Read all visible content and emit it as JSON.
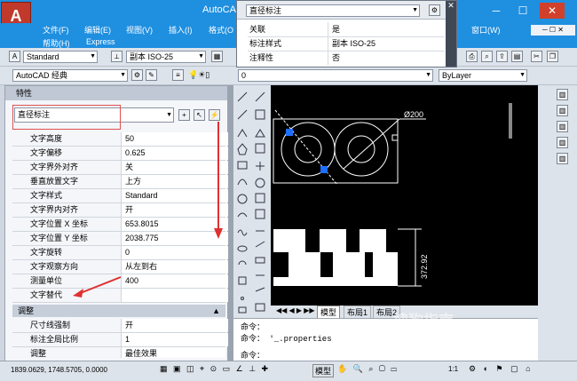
{
  "app": {
    "title": "AutoCAD"
  },
  "menu": {
    "items": [
      "文件(F)",
      "编辑(E)",
      "视图(V)",
      "插入(I)",
      "格式(O",
      "窗口(W)",
      "帮助(H)",
      "Express"
    ]
  },
  "toolbar1": {
    "style_combo": "Standard",
    "dimstyle_combo": "副本 ISO-25"
  },
  "toolbar2": {
    "workspace_combo": "AutoCAD 经典",
    "layer_combo": "0",
    "linetype_combo": "ByLayer"
  },
  "tooltip_panel": {
    "title": "直径标注",
    "rows": [
      {
        "key": "关联",
        "value": "是"
      },
      {
        "key": "标注样式",
        "value": "副本 ISO-25"
      },
      {
        "key": "注释性",
        "value": "否"
      }
    ]
  },
  "properties": {
    "header": "特性",
    "object_type": "直径标注",
    "rows": [
      {
        "key": "文字高度",
        "value": "50"
      },
      {
        "key": "文字偏移",
        "value": "0.625"
      },
      {
        "key": "文字界外对齐",
        "value": "关"
      },
      {
        "key": "垂直放置文字",
        "value": "上方"
      },
      {
        "key": "文字样式",
        "value": "Standard"
      },
      {
        "key": "文字界内对齐",
        "value": "开"
      },
      {
        "key": "文字位置 X 坐标",
        "value": "653.8015"
      },
      {
        "key": "文字位置 Y 坐标",
        "value": "2038.775"
      },
      {
        "key": "文字旋转",
        "value": "0"
      },
      {
        "key": "文字观察方向",
        "value": "从左到右"
      },
      {
        "key": "测量单位",
        "value": "400"
      },
      {
        "key": "文字替代",
        "value": ""
      }
    ],
    "section2": "调整",
    "rows2": [
      {
        "key": "尺寸线强制",
        "value": "开"
      },
      {
        "key": "标注全局比例",
        "value": "1"
      },
      {
        "key": "调整",
        "value": "最佳效果"
      }
    ]
  },
  "drawing": {
    "diameter_label": "Ø200",
    "dimension_label": "372.92"
  },
  "tabs": {
    "model": "模型",
    "layout1": "布局1",
    "layout2": "布局2"
  },
  "command": {
    "line1": "命令：",
    "line2": "命令： '_.properties",
    "line3": "命令："
  },
  "status": {
    "coords": "1839.0629, 1748.5705, 0.0000",
    "model": "模型",
    "scale": "1:1"
  },
  "watermark": {
    "text": "搜狗指南",
    "url": "zhinan.sogou.com"
  }
}
